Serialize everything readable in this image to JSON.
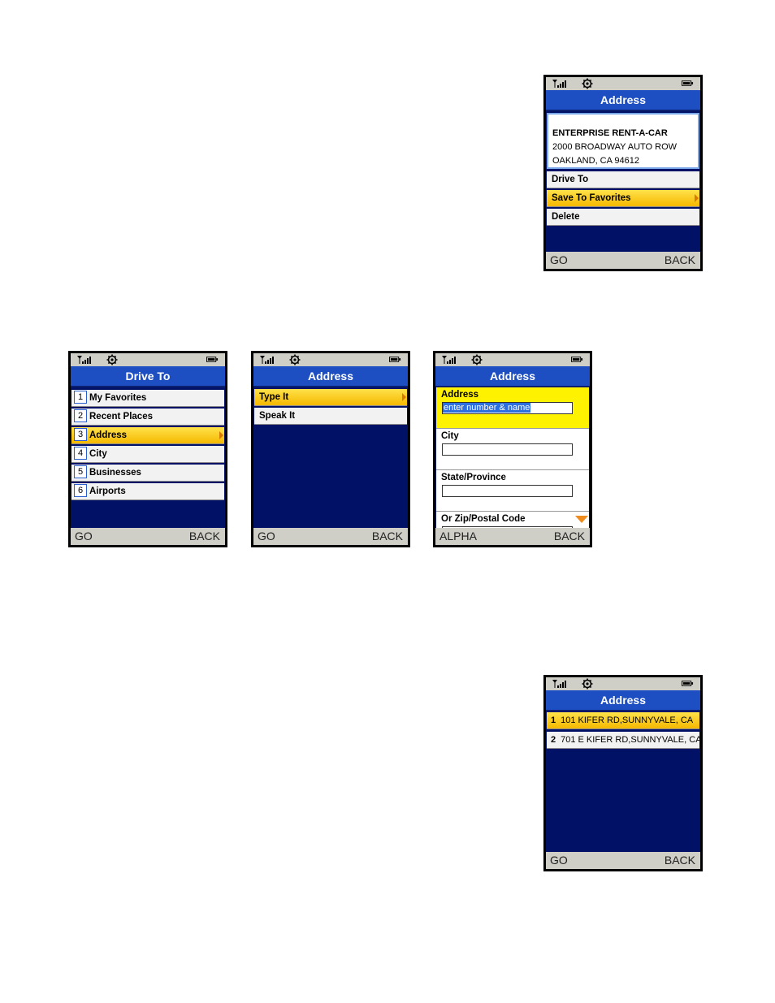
{
  "softkeys": {
    "go": "GO",
    "back": "BACK",
    "alpha": "ALPHA"
  },
  "screen_top": {
    "title": "Address",
    "address_lines": [
      "ENTERPRISE RENT-A-CAR",
      "2000 BROADWAY AUTO ROW",
      "OAKLAND, CA 94612"
    ],
    "menu": [
      "Drive To",
      "Save To Favorites",
      "Delete"
    ],
    "selected_index": 1
  },
  "screen_drive_to": {
    "title": "Drive To",
    "items": [
      {
        "num": "1",
        "label": "My Favorites"
      },
      {
        "num": "2",
        "label": "Recent Places"
      },
      {
        "num": "3",
        "label": "Address"
      },
      {
        "num": "4",
        "label": "City"
      },
      {
        "num": "5",
        "label": "Businesses"
      },
      {
        "num": "6",
        "label": "Airports"
      }
    ],
    "selected_index": 2
  },
  "screen_address_type": {
    "title": "Address",
    "items": [
      "Type It",
      "Speak It"
    ],
    "selected_index": 0
  },
  "screen_address_form": {
    "title": "Address",
    "fields": [
      {
        "label": "Address",
        "placeholder": "enter number & name"
      },
      {
        "label": "City"
      },
      {
        "label": "State/Province"
      },
      {
        "label": "Or Zip/Postal Code"
      }
    ]
  },
  "screen_results": {
    "title": "Address",
    "results": [
      {
        "num": "1",
        "text": "101 KIFER RD,SUNNYVALE, CA"
      },
      {
        "num": "2",
        "text": "701 E KIFER RD,SUNNYVALE, CA"
      }
    ],
    "selected_index": 0
  },
  "colors": {
    "title_bar": "#1e4fc2",
    "body": "#001166",
    "highlight": "#f5b800",
    "active_field": "#fff200"
  }
}
